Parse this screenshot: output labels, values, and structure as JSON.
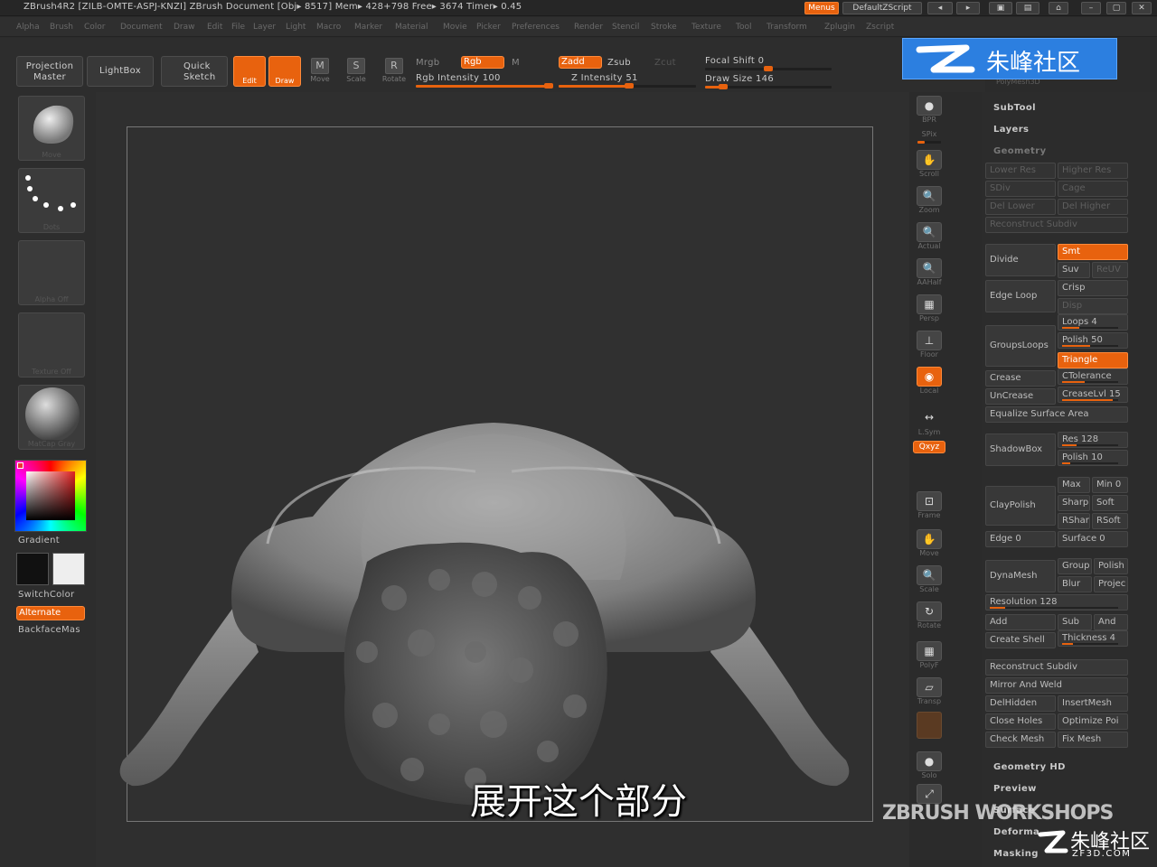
{
  "titlebar": {
    "title": "ZBrush4R2 [ZILB-OMTE-ASPJ-KNZI]    ZBrush Document     [Obj▸ 8517] Mem▸ 428+798  Free▸ 3674  Timer▸ 0.45",
    "menus_btn": "Menus",
    "script": "DefaultZScript"
  },
  "menubar": [
    "Alpha",
    "Brush",
    "Color",
    "Document",
    "Draw",
    "Edit",
    "File",
    "Layer",
    "Light",
    "Macro",
    "Marker",
    "Material",
    "Movie",
    "Picker",
    "Preferences",
    "Render",
    "Stencil",
    "Stroke",
    "Texture",
    "Tool",
    "Transform",
    "Zplugin",
    "Zscript"
  ],
  "toolbar": {
    "projection_master": "Projection\nMaster",
    "lightbox": "LightBox",
    "quick_sketch": "Quick\nSketch",
    "edit": "Edit",
    "draw": "Draw",
    "move": "Move",
    "scale": "Scale",
    "rotate": "Rotate",
    "mrgb": "Mrgb",
    "rgb": "Rgb",
    "m": "M",
    "rgb_intensity": "Rgb Intensity 100",
    "zadd": "Zadd",
    "zsub": "Zsub",
    "zcut": "Zcut",
    "z_intensity": "Z Intensity 51",
    "focal_shift": "Focal Shift 0",
    "draw_size": "Draw Size 146",
    "rgb_intensity_level": 1.0,
    "z_intensity_level": 0.51,
    "focal_shift_level": 0.0,
    "draw_size_level": 0.146
  },
  "left": {
    "brush_cap": "Move",
    "stroke_cap": "Dots",
    "alpha_cap": "Alpha Off",
    "texture_cap": "Texture Off",
    "material_cap": "MatCap Gray",
    "gradient": "Gradient",
    "switch_color": "SwitchColor",
    "alternate": "Alternate",
    "backface": "BackfaceMas"
  },
  "shelf": [
    {
      "label": "BPR",
      "icon": "bpr-icon",
      "glyph": "●"
    },
    {
      "label": "SPix",
      "icon": "spix-icon",
      "glyph": ""
    },
    {
      "label": "Scroll",
      "icon": "scroll-icon",
      "glyph": "✋"
    },
    {
      "label": "Zoom",
      "icon": "zoom-icon",
      "glyph": "🔍"
    },
    {
      "label": "Actual",
      "icon": "actual-icon",
      "glyph": "🔍"
    },
    {
      "label": "AAHalf",
      "icon": "aahalf-icon",
      "glyph": "🔍"
    },
    {
      "label": "Persp",
      "icon": "persp-icon",
      "glyph": "▦"
    },
    {
      "label": "Floor",
      "icon": "floor-icon",
      "glyph": "⊥"
    },
    {
      "label": "Local",
      "icon": "local-icon",
      "glyph": "◉"
    },
    {
      "label": "L.Sym",
      "icon": "lsym-icon",
      "glyph": "↔"
    },
    {
      "label": "Qxyz",
      "icon": "xyz-icon",
      "glyph": ""
    },
    {
      "label": "Frame",
      "icon": "frame-icon",
      "glyph": "⊡"
    },
    {
      "label": "Move",
      "icon": "move-icon",
      "glyph": "✋"
    },
    {
      "label": "Scale",
      "icon": "scale-icon",
      "glyph": "🔍"
    },
    {
      "label": "Rotate",
      "icon": "rotate-icon",
      "glyph": "↻"
    },
    {
      "label": "PolyF",
      "icon": "polyf-icon",
      "glyph": "▦"
    },
    {
      "label": "Transp",
      "icon": "transp-icon",
      "glyph": "▱"
    },
    {
      "label": "",
      "icon": "ghost-icon",
      "glyph": ""
    },
    {
      "label": "Solo",
      "icon": "solo-icon",
      "glyph": "●"
    },
    {
      "label": "",
      "icon": "xpose-icon",
      "glyph": "⤢"
    }
  ],
  "right": {
    "polymesh": "PolyMesh3D",
    "subtool": "SubTool",
    "layers": "Layers",
    "geometry": "Geometry",
    "lower_res": "Lower Res",
    "higher_res": "Higher Res",
    "sdiv": "SDiv",
    "cage": "Cage",
    "del_lower": "Del Lower",
    "del_higher": "Del Higher",
    "reconstruct": "Reconstruct Subdiv",
    "divide": "Divide",
    "smt": "Smt",
    "suv": "Suv",
    "reuv": "ReUV",
    "edge_loop": "Edge Loop",
    "crisp": "Crisp",
    "disp": "Disp",
    "groups_loops": "GroupsLoops",
    "loops": "Loops 4",
    "polish_50": "Polish 50",
    "triangle": "Triangle",
    "crease": "Crease",
    "ctolerance": "CTolerance",
    "uncrease": "UnCrease",
    "creaselvl": "CreaseLvl 15",
    "equalize": "Equalize Surface Area",
    "shadowbox": "ShadowBox",
    "res": "Res 128",
    "polish_10": "Polish 10",
    "claypolish": "ClayPolish",
    "max": "Max",
    "min0": "Min 0",
    "sharp": "Sharp",
    "soft": "Soft",
    "rshar": "RShar",
    "rsoft": "RSoft",
    "edge0": "Edge 0",
    "surface0": "Surface 0",
    "dynamesh": "DynaMesh",
    "group": "Group",
    "polish": "Polish",
    "blur": "Blur",
    "project": "Projec",
    "resolution": "Resolution 128",
    "add": "Add",
    "sub": "Sub",
    "and": "And",
    "create_shell": "Create Shell",
    "thickness": "Thickness 4",
    "reconstruct2": "Reconstruct Subdiv",
    "mirror_weld": "Mirror And Weld",
    "delhidden": "DelHidden",
    "insertmesh": "InsertMesh",
    "close_holes": "Close Holes",
    "optimize": "Optimize Poi",
    "check_mesh": "Check Mesh",
    "fix_mesh": "Fix Mesh",
    "geometry_hd": "Geometry HD",
    "preview": "Preview",
    "surface": "Surface",
    "deformation": "Deforma",
    "masking": "Masking"
  },
  "watermark": {
    "top": "朱峰社区",
    "brand": "ZBRUSH WORKSHOPS",
    "cn": "朱峰社区",
    "url": "ZF3D.COM"
  },
  "subtitle": "展开这个部分",
  "colors": {
    "accent": "#e8620e",
    "bg": "#2b2b2b"
  }
}
